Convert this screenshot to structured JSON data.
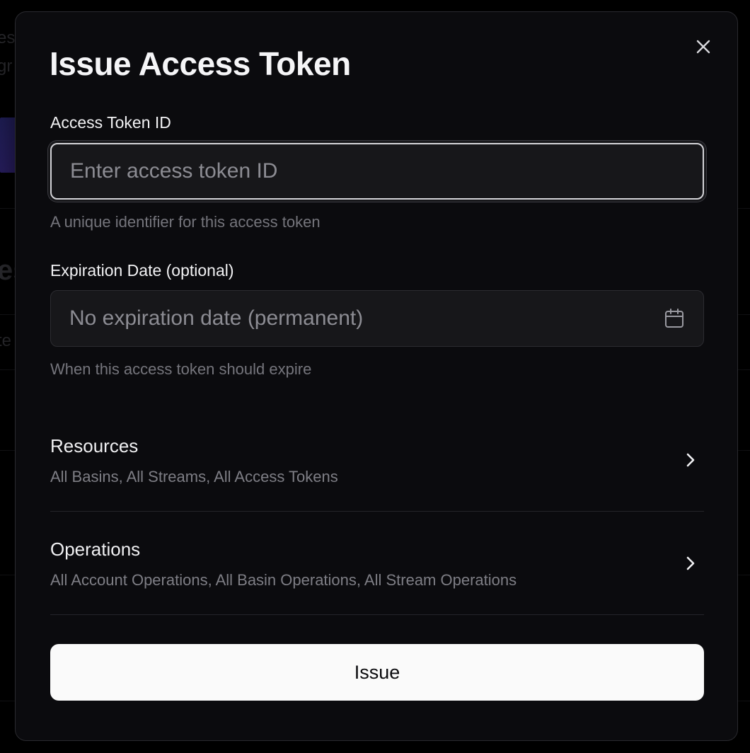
{
  "dialog": {
    "title": "Issue Access Token",
    "close_icon": "close-icon"
  },
  "token_id": {
    "label": "Access Token ID",
    "value": "",
    "placeholder": "Enter access token ID",
    "help": "A unique identifier for this access token"
  },
  "expiration": {
    "label": "Expiration Date (optional)",
    "placeholder": "No expiration date (permanent)",
    "help": "When this access token should expire",
    "icon": "calendar-icon"
  },
  "resources": {
    "title": "Resources",
    "summary": "All Basins, All Streams, All Access Tokens",
    "icon": "chevron-right-icon"
  },
  "operations": {
    "title": "Operations",
    "summary": "All Account Operations, All Basin Operations, All Stream Operations",
    "icon": "chevron-right-icon"
  },
  "actions": {
    "issue_label": "Issue"
  },
  "colors": {
    "modal_bg": "#0b0b0e",
    "field_bg": "#17171a",
    "primary_button_bg": "#fafafa",
    "text_primary": "#f2f2f4",
    "text_muted": "#75757c"
  }
}
